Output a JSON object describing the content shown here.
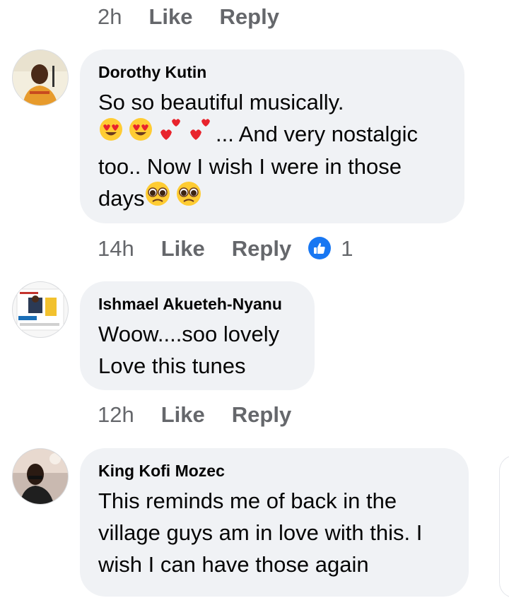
{
  "comments": [
    {
      "time": "2h",
      "like_label": "Like",
      "reply_label": "Reply"
    },
    {
      "author": "Dorothy Kutin",
      "text_line1": "So so beautiful musically.",
      "text_line2_suffix": "... And very nostalgic",
      "text_line3": "too.. Now I wish I were in those",
      "text_line4": "days",
      "emojis": [
        "heart-eyes-emoji",
        "heart-eyes-emoji",
        "two-hearts-emoji",
        "two-hearts-emoji",
        "pleading-face-emoji",
        "pleading-face-emoji"
      ],
      "time": "14h",
      "like_label": "Like",
      "reply_label": "Reply",
      "reaction_icon": "thumbs-up-icon",
      "reaction_count": "1"
    },
    {
      "author": "Ishmael Akueteh-Nyanu",
      "text_line1": "Woow....soo lovely",
      "text_line2": "Love this tunes",
      "time": "12h",
      "like_label": "Like",
      "reply_label": "Reply"
    },
    {
      "author": "King Kofi Mozec",
      "text_line1": "This reminds me of back in the",
      "text_line2": "village guys am in love with this. I",
      "text_line3": "wish I can have those again"
    }
  ],
  "colors": {
    "bubble_bg": "#f0f2f5",
    "meta_text": "#65676b",
    "reaction_blue": "#1877f2",
    "text": "#050505"
  }
}
